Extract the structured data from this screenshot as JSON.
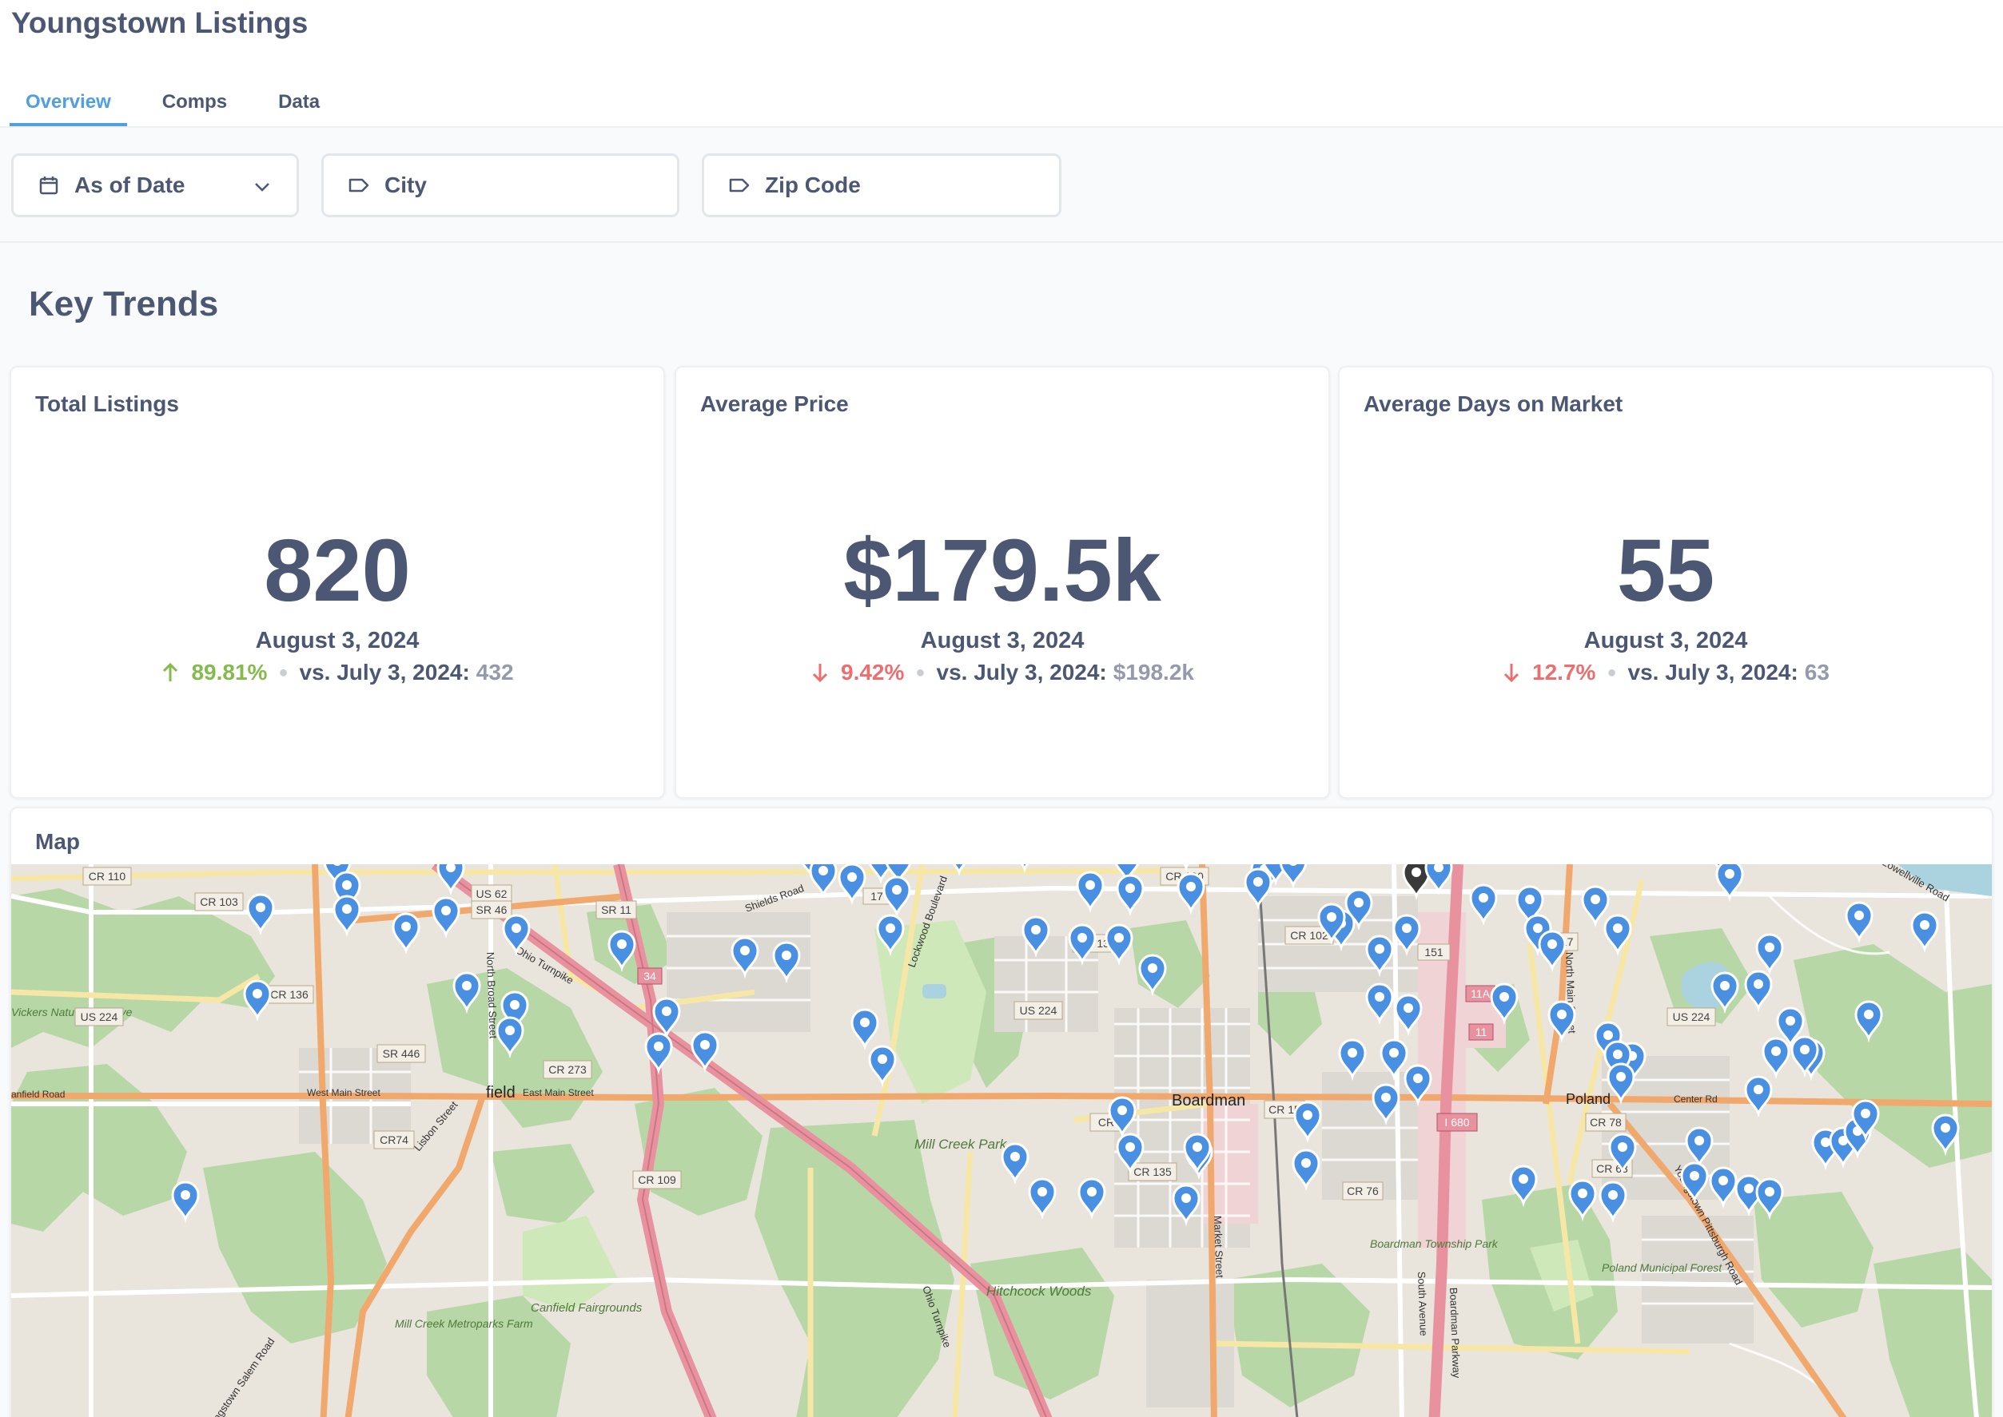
{
  "header": {
    "title": "Youngstown Listings",
    "tabs": [
      {
        "label": "Overview",
        "active": true
      },
      {
        "label": "Comps",
        "active": false
      },
      {
        "label": "Data",
        "active": false
      }
    ]
  },
  "filters": {
    "date": {
      "label": "As of Date",
      "icon": "calendar-icon"
    },
    "city": {
      "label": "City",
      "icon": "tag-icon"
    },
    "zip": {
      "label": "Zip Code",
      "icon": "tag-icon"
    }
  },
  "section_title": "Key Trends",
  "cards": [
    {
      "title": "Total Listings",
      "value": "820",
      "date": "August 3, 2024",
      "direction": "up",
      "change": "89.81%",
      "compare_label": "vs. July 3, 2024:",
      "compare_value": "432"
    },
    {
      "title": "Average Price",
      "value": "$179.5k",
      "date": "August 3, 2024",
      "direction": "down",
      "change": "9.42%",
      "compare_label": "vs. July 3, 2024:",
      "compare_value": "$198.2k"
    },
    {
      "title": "Average Days on Market",
      "value": "55",
      "date": "August 3, 2024",
      "direction": "down",
      "change": "12.7%",
      "compare_label": "vs. July 3, 2024:",
      "compare_value": "63"
    }
  ],
  "map": {
    "title": "Map",
    "labels": {
      "boardman": "Boardman",
      "canfield": "field",
      "poland": "Poland",
      "mill_creek_park": "Mill Creek Park",
      "hitchcock_woods": "Hitchcock Woods",
      "canfield_fairgrounds": "Canfield Fairgrounds",
      "mill_creek_metroparks_farm": "Mill Creek Metroparks Farm",
      "vickers_nature_preserve": "Vickers Nature Preserve",
      "poland_forest": "Poland Municipal Forest",
      "boardman_park": "Boardman Township Park",
      "ohio_turnpike": "Ohio Turnpike",
      "west_main_street": "West Main Street",
      "east_main_street": "East Main Street",
      "canfield_road": "anfield Road",
      "center_road": "Center Rd",
      "market_street": "Market Street",
      "boardman_parkway": "Boardman Parkway",
      "lockwood_boulevard": "Lockwood Boulevard",
      "south_avenue": "South Avenue",
      "youngstown_pittsburgh_road": "Youngstown Pittsburgh Road",
      "north_broad_street": "North Broad Street",
      "lisbon_street": "Lisbon Street",
      "shields_road": "Shields Road",
      "youngstown_salem_road": "ungstown Salem Road",
      "north_main_street": "North Main Street",
      "lowellville_road": "Lowellville Road"
    },
    "shields": {
      "cr110": "CR 110",
      "cr103": "CR 103",
      "us62": "US 62",
      "sr46": "SR 46",
      "sr11": "SR 11",
      "cr100": "CR 100",
      "cr137": "CR 137",
      "cr102": "CR 102",
      "sr17": "SR 17",
      "us224a": "US 224",
      "us224b": "US 224",
      "us224c": "US 224",
      "cr136": "CR 136",
      "sr446": "SR 446",
      "cr273": "CR 273",
      "cr74": "CR74",
      "cr109": "CR 109",
      "cr135": "CR 135",
      "cr76": "CR 76",
      "cr78": "CR 78",
      "cr63": "CR 63",
      "i680": "I 680",
      "cr15": "CR 15",
      "cr": "CR",
      "n151": "151",
      "n17": "17",
      "n11a": "11A",
      "n11": "11",
      "n34": "34"
    }
  }
}
